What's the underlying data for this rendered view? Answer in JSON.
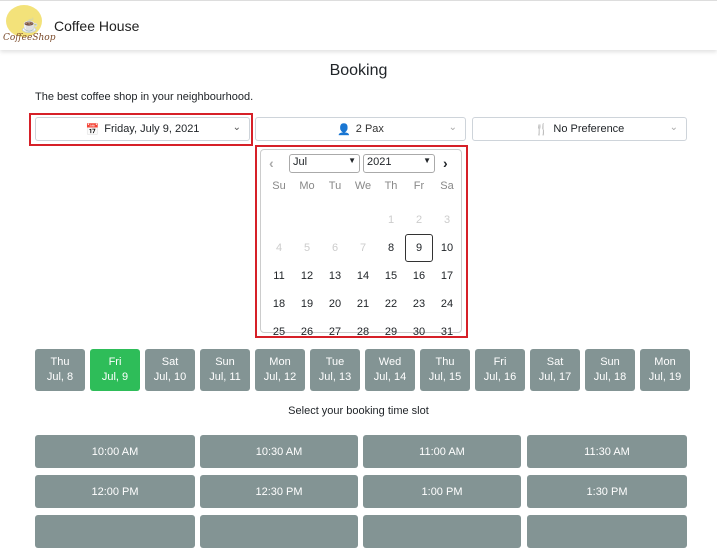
{
  "header": {
    "brand": "Coffee House",
    "logo_text": "CoffeeShop"
  },
  "page": {
    "title": "Booking",
    "subtitle": "The best coffee shop in your neighbourhood."
  },
  "filters": {
    "date": "Friday, July 9, 2021",
    "pax": "2 Pax",
    "preference": "No Preference"
  },
  "calendar": {
    "month": "Jul",
    "year": "2021",
    "weekdays": [
      "Su",
      "Mo",
      "Tu",
      "We",
      "Th",
      "Fr",
      "Sa"
    ],
    "days": [
      [
        "",
        "",
        "",
        "",
        "1",
        "2",
        "3"
      ],
      [
        "4",
        "5",
        "6",
        "7",
        "8",
        "9",
        "10"
      ],
      [
        "11",
        "12",
        "13",
        "14",
        "15",
        "16",
        "17"
      ],
      [
        "18",
        "19",
        "20",
        "21",
        "22",
        "23",
        "24"
      ],
      [
        "25",
        "26",
        "27",
        "28",
        "29",
        "30",
        "31"
      ]
    ],
    "disabled_through": 7,
    "selected": "9"
  },
  "day_strip": [
    {
      "dow": "Thu",
      "date": "Jul, 8"
    },
    {
      "dow": "Fri",
      "date": "Jul, 9",
      "active": true
    },
    {
      "dow": "Sat",
      "date": "Jul, 10"
    },
    {
      "dow": "Sun",
      "date": "Jul, 11"
    },
    {
      "dow": "Mon",
      "date": "Jul, 12"
    },
    {
      "dow": "Tue",
      "date": "Jul, 13"
    },
    {
      "dow": "Wed",
      "date": "Jul, 14"
    },
    {
      "dow": "Thu",
      "date": "Jul, 15"
    },
    {
      "dow": "Fri",
      "date": "Jul, 16"
    },
    {
      "dow": "Sat",
      "date": "Jul, 17"
    },
    {
      "dow": "Sun",
      "date": "Jul, 18"
    },
    {
      "dow": "Mon",
      "date": "Jul, 19"
    }
  ],
  "time_hint": "Select your booking time slot",
  "slots": [
    "10:00 AM",
    "10:30 AM",
    "11:00 AM",
    "11:30 AM",
    "12:00 PM",
    "12:30 PM",
    "1:00 PM",
    "1:30 PM",
    "",
    "",
    "",
    ""
  ],
  "colors": {
    "active": "#2ebd59",
    "button": "#839494",
    "highlight": "#d62028"
  }
}
